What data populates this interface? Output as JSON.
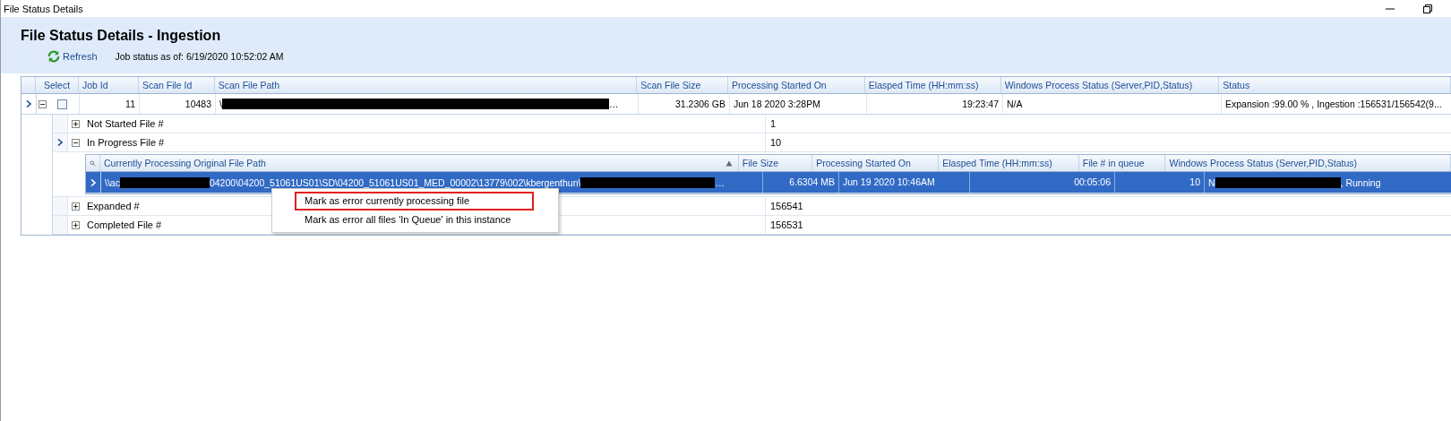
{
  "window": {
    "title": "File Status Details"
  },
  "header": {
    "title": "File Status Details - Ingestion",
    "refresh": "Refresh",
    "job_status": "Job status as of: 6/19/2020 10:52:02 AM"
  },
  "grid": {
    "columns": [
      "Select",
      "Job Id",
      "Scan File Id",
      "Scan File Path",
      "Scan File Size",
      "Processing Started On",
      "Elasped Time (HH:mm:ss)",
      "Windows Process Status (Server,PID,Status)",
      "Status"
    ],
    "row": {
      "checked": false,
      "expanded": true,
      "job_id": "11",
      "scan_file_id": "10483",
      "path_start": "\\",
      "path_end": "…",
      "size": "31.2306 GB",
      "started": "Jun 18 2020  3:28PM",
      "elapsed": "19:23:47",
      "process": "N/A",
      "status": "Expansion :99.00 % , Ingestion :156531/156542(9..."
    },
    "details": [
      {
        "label": "Not Started File #",
        "value": "1",
        "expanded": false,
        "current": false
      },
      {
        "label": "In Progress File #",
        "value": "10",
        "expanded": true,
        "current": true,
        "nested": {
          "columns": [
            "Currently Processing Original File Path",
            "File Size",
            "Processing Started On",
            "Elasped Time (HH:mm:ss)",
            "File # in queue",
            "Windows Process Status (Server,PID,Status)"
          ],
          "row": {
            "selected": true,
            "path_parts": [
              "\\\\ac",
              "04200\\04200_51061US01\\SD\\04200_51061US01_MED_00002\\13779\\002\\kbergenthun\\",
              "…"
            ],
            "size": "6.6304 MB",
            "started": "Jun 19 2020 10:46AM",
            "elapsed": "00:05:06",
            "queue": "10",
            "process_start": "N",
            "process_end": ", Running"
          }
        }
      },
      {
        "label": "Expanded #",
        "value": "156541",
        "expanded": false,
        "current": false
      },
      {
        "label": "Completed File #",
        "value": "156531",
        "expanded": false,
        "current": false
      }
    ]
  },
  "context_menu": {
    "items": [
      {
        "label": "Mark as error currently processing file",
        "highlighted": true
      },
      {
        "label": "Mark as error all files 'In Queue' in this instance",
        "highlighted": false
      }
    ]
  }
}
